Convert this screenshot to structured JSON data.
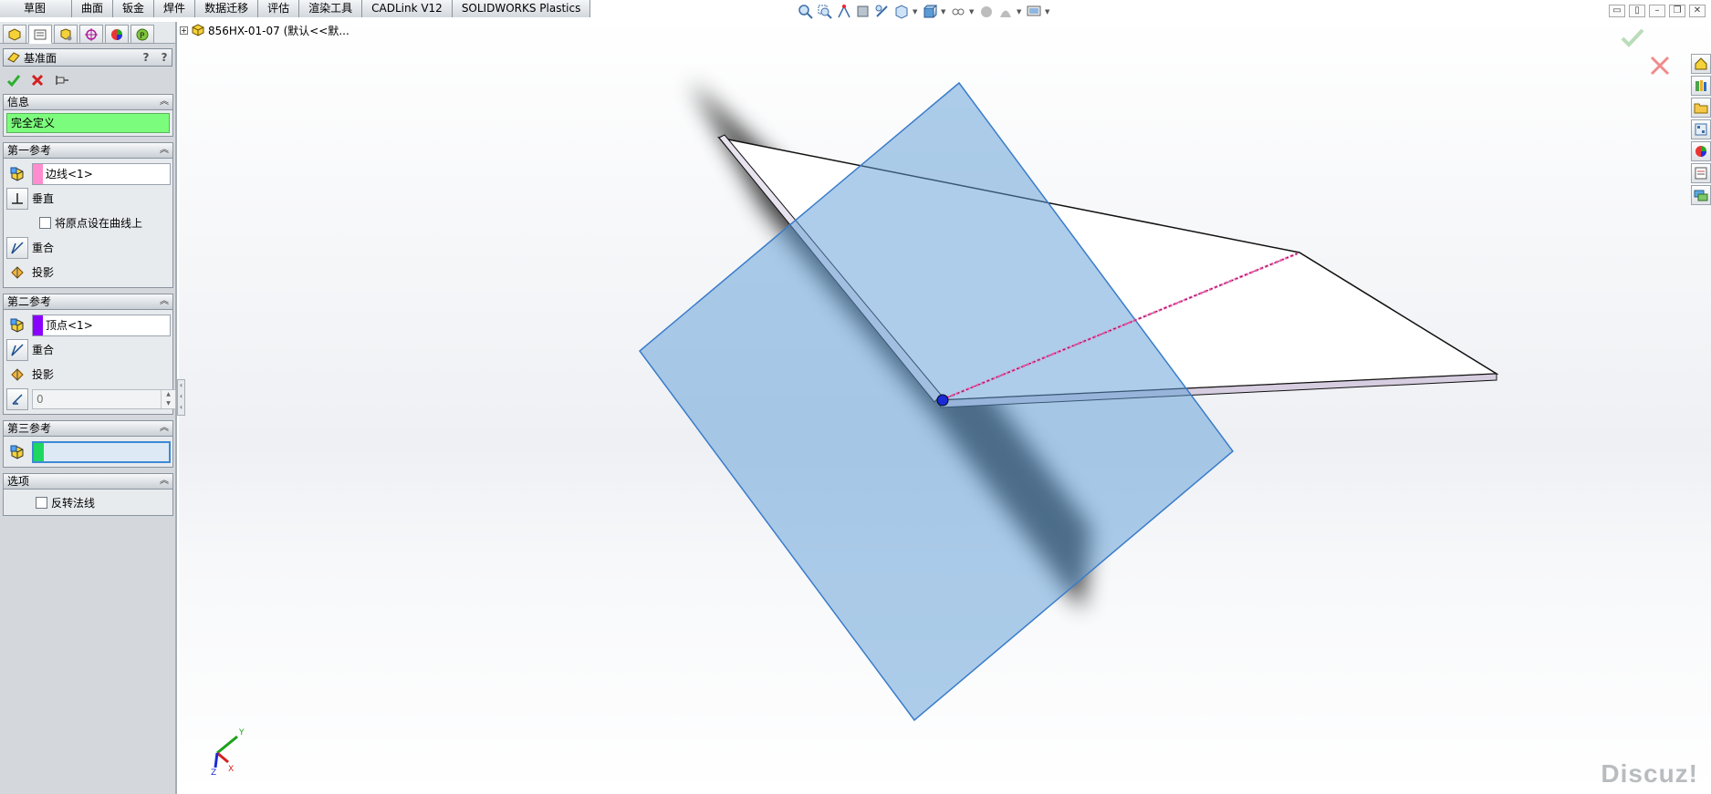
{
  "command_tabs": [
    "草图",
    "曲面",
    "钣金",
    "焊件",
    "数据迁移",
    "评估",
    "渲染工具",
    "CADLink V12",
    "SOLIDWORKS Plastics"
  ],
  "tree_label": "856HX-01-07  (默认<<默...",
  "property_manager": {
    "title": "基准面",
    "info": {
      "header": "信息",
      "status": "完全定义"
    },
    "first_ref": {
      "header": "第一参考",
      "selection": "边线<1>",
      "swatch": "#ff8ccf",
      "perpendicular": "垂直",
      "origin_on_curve": "将原点设在曲线上",
      "coincident": "重合",
      "project": "投影"
    },
    "second_ref": {
      "header": "第二参考",
      "selection": "顶点<1>",
      "swatch": "#8a00ff",
      "coincident": "重合",
      "project": "投影",
      "angle_value": "0"
    },
    "third_ref": {
      "header": "第三参考",
      "selection": "",
      "swatch": "#1ed760"
    },
    "options": {
      "header": "选项",
      "flip_normal": "反转法线"
    }
  },
  "colors": {
    "plane_fill": "#5b9bd5",
    "plane_edge": "#3a7cc9",
    "ok_green": "#2bb02b",
    "cancel_red": "#d22020",
    "status_green": "#7cfc7c"
  },
  "triad": {
    "x": "X",
    "y": "Y",
    "z": "Z"
  },
  "watermark": "Discuz!"
}
